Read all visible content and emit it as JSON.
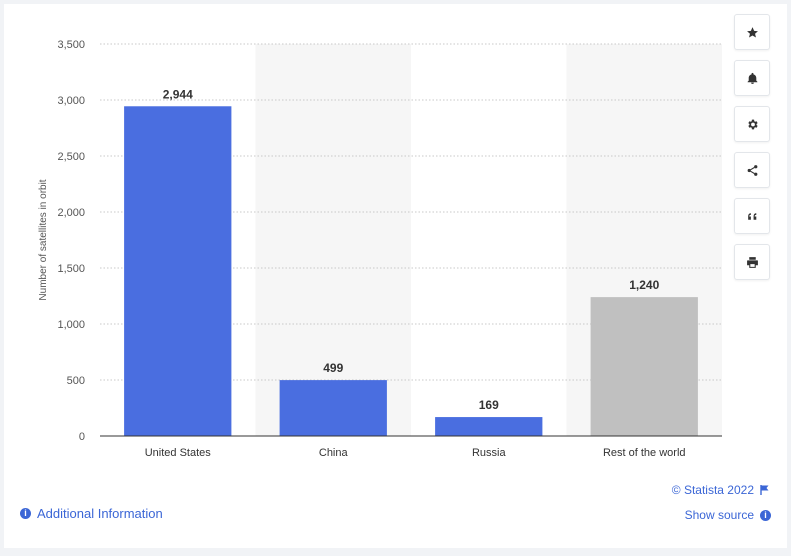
{
  "chart_data": {
    "type": "bar",
    "categories": [
      "United States",
      "China",
      "Russia",
      "Rest of the world"
    ],
    "values": [
      2944,
      499,
      169,
      1240
    ],
    "value_labels": [
      "2,944",
      "499",
      "169",
      "1,240"
    ],
    "bar_colors": [
      "#4a6ee0",
      "#4a6ee0",
      "#4a6ee0",
      "#c0c0c0"
    ],
    "title": "",
    "xlabel": "",
    "ylabel": "Number of satellites in orbit",
    "ylim": [
      0,
      3500
    ],
    "yticks": [
      0,
      500,
      1000,
      1500,
      2000,
      2500,
      3000,
      3500
    ],
    "ytick_labels": [
      "0",
      "500",
      "1,000",
      "1,500",
      "2,000",
      "2,500",
      "3,000",
      "3,500"
    ],
    "grid": true,
    "legend": "none"
  },
  "toolbar": {
    "buttons": [
      {
        "icon": "star-icon"
      },
      {
        "icon": "bell-icon"
      },
      {
        "icon": "gear-icon"
      },
      {
        "icon": "share-icon"
      },
      {
        "icon": "quote-icon"
      },
      {
        "icon": "print-icon"
      }
    ]
  },
  "footer": {
    "additional_info": "Additional Information",
    "copyright": "© Statista 2022",
    "show_source": "Show source"
  },
  "colors": {
    "accent": "#3b66d6",
    "bar_primary": "#4a6ee0",
    "bar_other": "#c0c0c0",
    "band": "#f6f6f6"
  }
}
